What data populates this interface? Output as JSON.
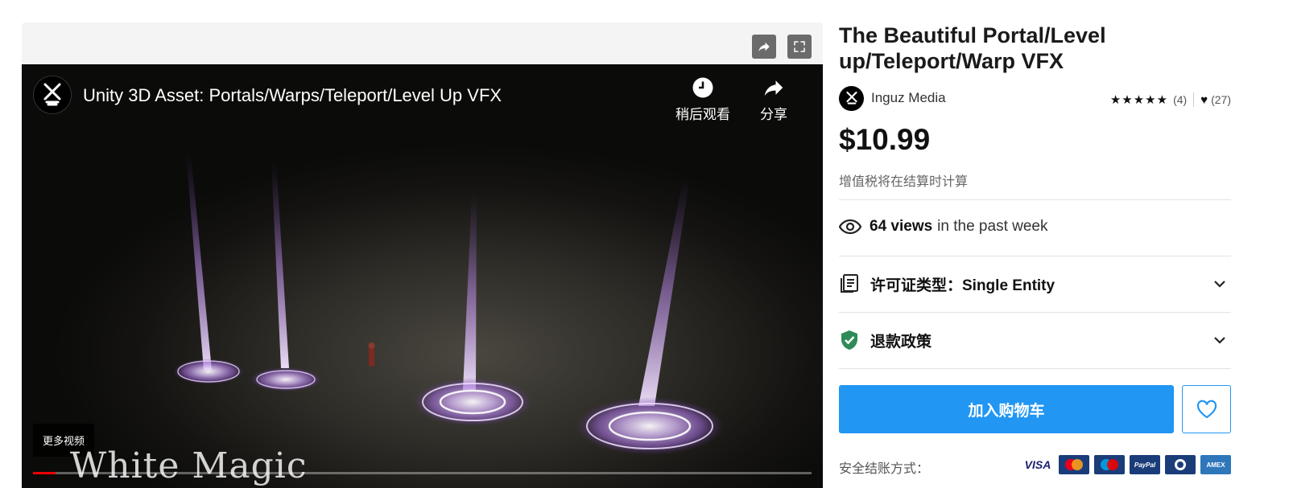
{
  "video": {
    "title": "Unity 3D Asset: Portals/Warps/Teleport/Level Up VFX",
    "watch_later_label": "稍后观看",
    "share_label": "分享",
    "more_videos_label": "更多视频",
    "watermark_text": "White Magic"
  },
  "product": {
    "title": "The Beautiful Portal/Level up/Teleport/Warp VFX",
    "seller": "Inguz Media",
    "rating_stars": "★★★★★",
    "rating_count": "(4)",
    "favorites_count": "(27)",
    "price": "$10.99",
    "tax_note": "增值税将在结算时计算",
    "views_count": "64 views",
    "views_suffix": "in the past week",
    "license_label": "许可证类型：Single Entity",
    "refund_label": "退款政策",
    "add_to_cart_label": "加入购物车",
    "secure_checkout_label": "安全结账方式：",
    "payment_methods": [
      "VISA",
      "Mastercard",
      "Maestro",
      "PayPal",
      "Diners",
      "AMEX"
    ]
  },
  "colors": {
    "accent": "#2196f3",
    "refund_shield": "#2e8b57"
  }
}
